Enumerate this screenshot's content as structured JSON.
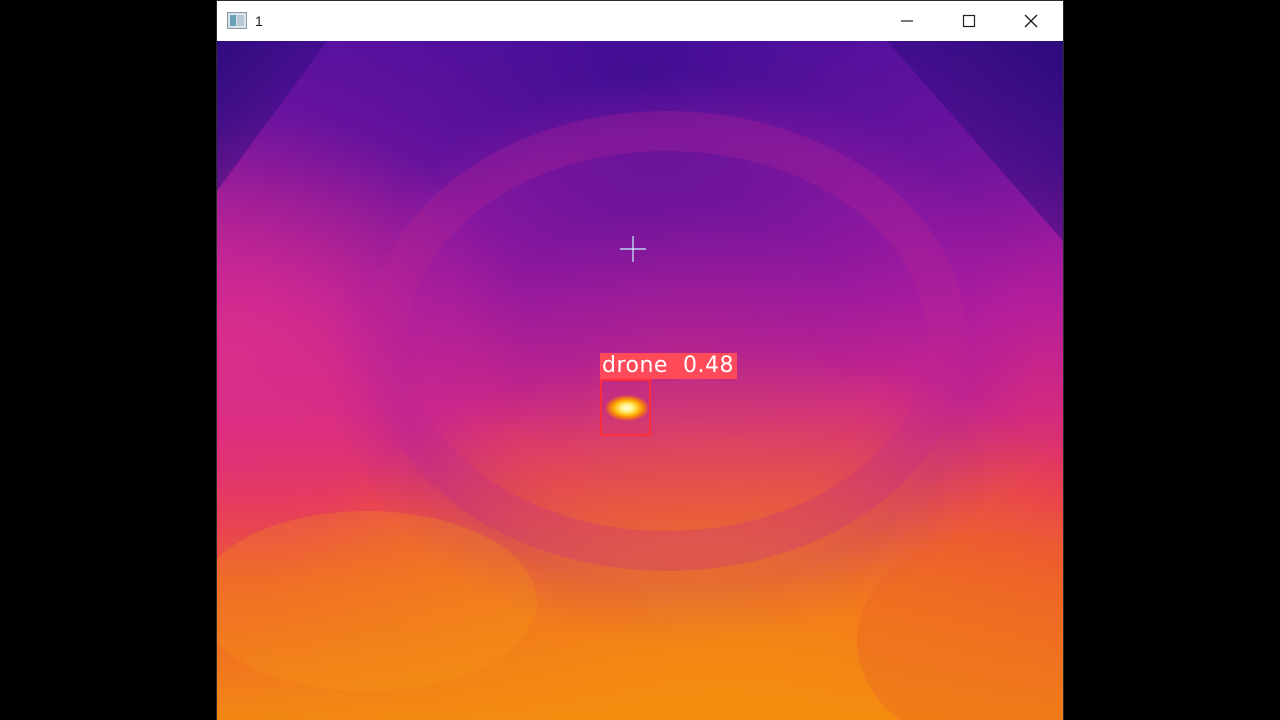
{
  "window": {
    "title": "1",
    "icon": "app-window-icon"
  },
  "caption_buttons": {
    "minimize_icon": "minimize-icon",
    "maximize_icon": "maximize-icon",
    "close_icon": "close-icon"
  },
  "frame": {
    "palette": "inferno-thermal",
    "colors": {
      "cold": "#3d0d92",
      "mid": "#c21f9a",
      "warm": "#e9334f",
      "hot": "#f08a13",
      "hotspot": "#fff7c0"
    }
  },
  "detection": {
    "label": "drone",
    "confidence": "0.48",
    "box_color": "#ff2d3b",
    "label_bg": "#ff4a5a"
  },
  "overlay": {
    "crosshair_icon": "crosshair-icon",
    "crosshair_color": "#c8f5ff"
  }
}
